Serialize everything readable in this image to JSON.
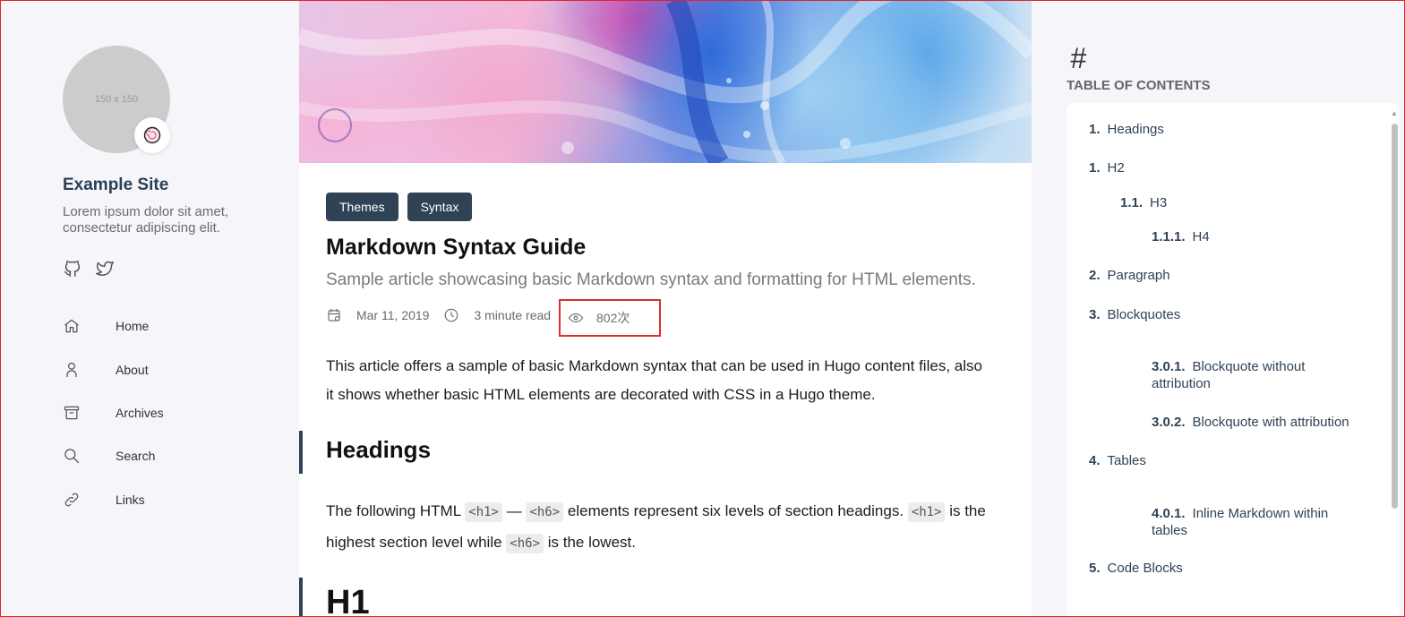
{
  "sidebar": {
    "avatar_placeholder": "150 x 150",
    "avatar_emoji": "🍥",
    "site_name": "Example Site",
    "site_description": "Lorem ipsum dolor sit amet, consectetur adipiscing elit.",
    "social": [
      {
        "icon": "github-icon"
      },
      {
        "icon": "twitter-icon"
      }
    ],
    "menu": [
      {
        "icon": "home-icon",
        "label": "Home"
      },
      {
        "icon": "user-icon",
        "label": "About"
      },
      {
        "icon": "archive-icon",
        "label": "Archives"
      },
      {
        "icon": "search-icon",
        "label": "Search"
      },
      {
        "icon": "link-icon",
        "label": "Links"
      }
    ]
  },
  "article": {
    "categories": [
      "Themes",
      "Syntax"
    ],
    "title": "Markdown Syntax Guide",
    "subtitle": "Sample article showcasing basic Markdown syntax and formatting for HTML elements.",
    "date": "Mar 11, 2019",
    "read_time": "3 minute read",
    "views": "802次",
    "intro": "This article offers a sample of basic Markdown syntax that can be used in Hugo content files, also it shows whether basic HTML elements are decorated with CSS in a Hugo theme.",
    "heading_section": "Headings",
    "para_part1": "The following HTML ",
    "code_h1": "<h1>",
    "para_dash": "—",
    "code_h6": "<h6>",
    "para_part2": " elements represent six levels of section headings. ",
    "code_h1_b": "<h1>",
    "para_part3": " is the highest section level while ",
    "code_h6_b": "<h6>",
    "para_part4": " is the lowest.",
    "h1_example": "H1"
  },
  "toc": {
    "hash": "#",
    "title": "TABLE OF CONTENTS",
    "items": [
      {
        "num": "1.",
        "label": "Headings"
      },
      {
        "num": "1.",
        "label": "H2"
      },
      {
        "num": "1.1.",
        "label": "H3"
      },
      {
        "num": "1.1.1.",
        "label": "H4"
      },
      {
        "num": "2.",
        "label": "Paragraph"
      },
      {
        "num": "3.",
        "label": "Blockquotes"
      },
      {
        "num": "3.0.1.",
        "label": "Blockquote without attribution"
      },
      {
        "num": "3.0.2.",
        "label": "Blockquote with attribution"
      },
      {
        "num": "4.",
        "label": "Tables"
      },
      {
        "num": "4.0.1.",
        "label": "Inline Markdown within tables"
      },
      {
        "num": "5.",
        "label": "Code Blocks"
      }
    ]
  },
  "colors": {
    "accent": "#2f4256",
    "highlight_border": "#d9302f",
    "page_background": "#f5f5fa"
  }
}
